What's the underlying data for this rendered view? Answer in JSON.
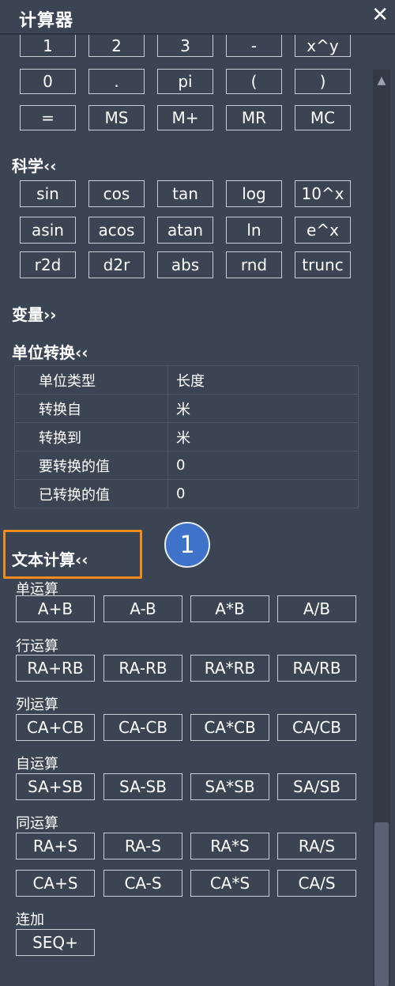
{
  "window": {
    "title": "计算器",
    "close_label": "✕"
  },
  "basic": {
    "row1": [
      "1",
      "2",
      "3",
      "-",
      "x^y"
    ],
    "row2": [
      "0",
      ".",
      "pi",
      "(",
      ")"
    ],
    "row3": [
      "=",
      "MS",
      "M+",
      "MR",
      "MC"
    ]
  },
  "science": {
    "heading": "科学‹‹",
    "row1": [
      "sin",
      "cos",
      "tan",
      "log",
      "10^x"
    ],
    "row2": [
      "asin",
      "acos",
      "atan",
      "ln",
      "e^x"
    ],
    "row3": [
      "r2d",
      "d2r",
      "abs",
      "rnd",
      "trunc"
    ]
  },
  "variables": {
    "heading": "变量››"
  },
  "unit_conversion": {
    "heading": "单位转换‹‹",
    "rows": [
      {
        "key": "单位类型",
        "value": "长度"
      },
      {
        "key": "转换自",
        "value": "米"
      },
      {
        "key": "转换到",
        "value": "米"
      },
      {
        "key": "要转换的值",
        "value": "0"
      },
      {
        "key": "已转换的值",
        "value": "0"
      }
    ]
  },
  "text_calc": {
    "heading": "文本计算‹‹",
    "badge": "1",
    "cell_ops": {
      "label": "单运算",
      "buttons": [
        "A+B",
        "A-B",
        "A*B",
        "A/B"
      ]
    },
    "row_ops": {
      "label": "行运算",
      "buttons": [
        "RA+RB",
        "RA-RB",
        "RA*RB",
        "RA/RB"
      ]
    },
    "col_ops": {
      "label": "列运算",
      "buttons": [
        "CA+CB",
        "CA-CB",
        "CA*CB",
        "CA/CB"
      ]
    },
    "self_ops": {
      "label": "自运算",
      "buttons": [
        "SA+SB",
        "SA-SB",
        "SA*SB",
        "SA/SB"
      ]
    },
    "same_ops": {
      "label": "同运算",
      "row1": [
        "RA+S",
        "RA-S",
        "RA*S",
        "RA/S"
      ],
      "row2": [
        "CA+S",
        "CA-S",
        "CA*S",
        "CA/S"
      ]
    },
    "sum": {
      "label": "连加",
      "buttons": [
        "SEQ+"
      ]
    }
  },
  "colors": {
    "background": "#3b4453",
    "highlight": "#f28c1e",
    "badge": "#3f72c9"
  }
}
